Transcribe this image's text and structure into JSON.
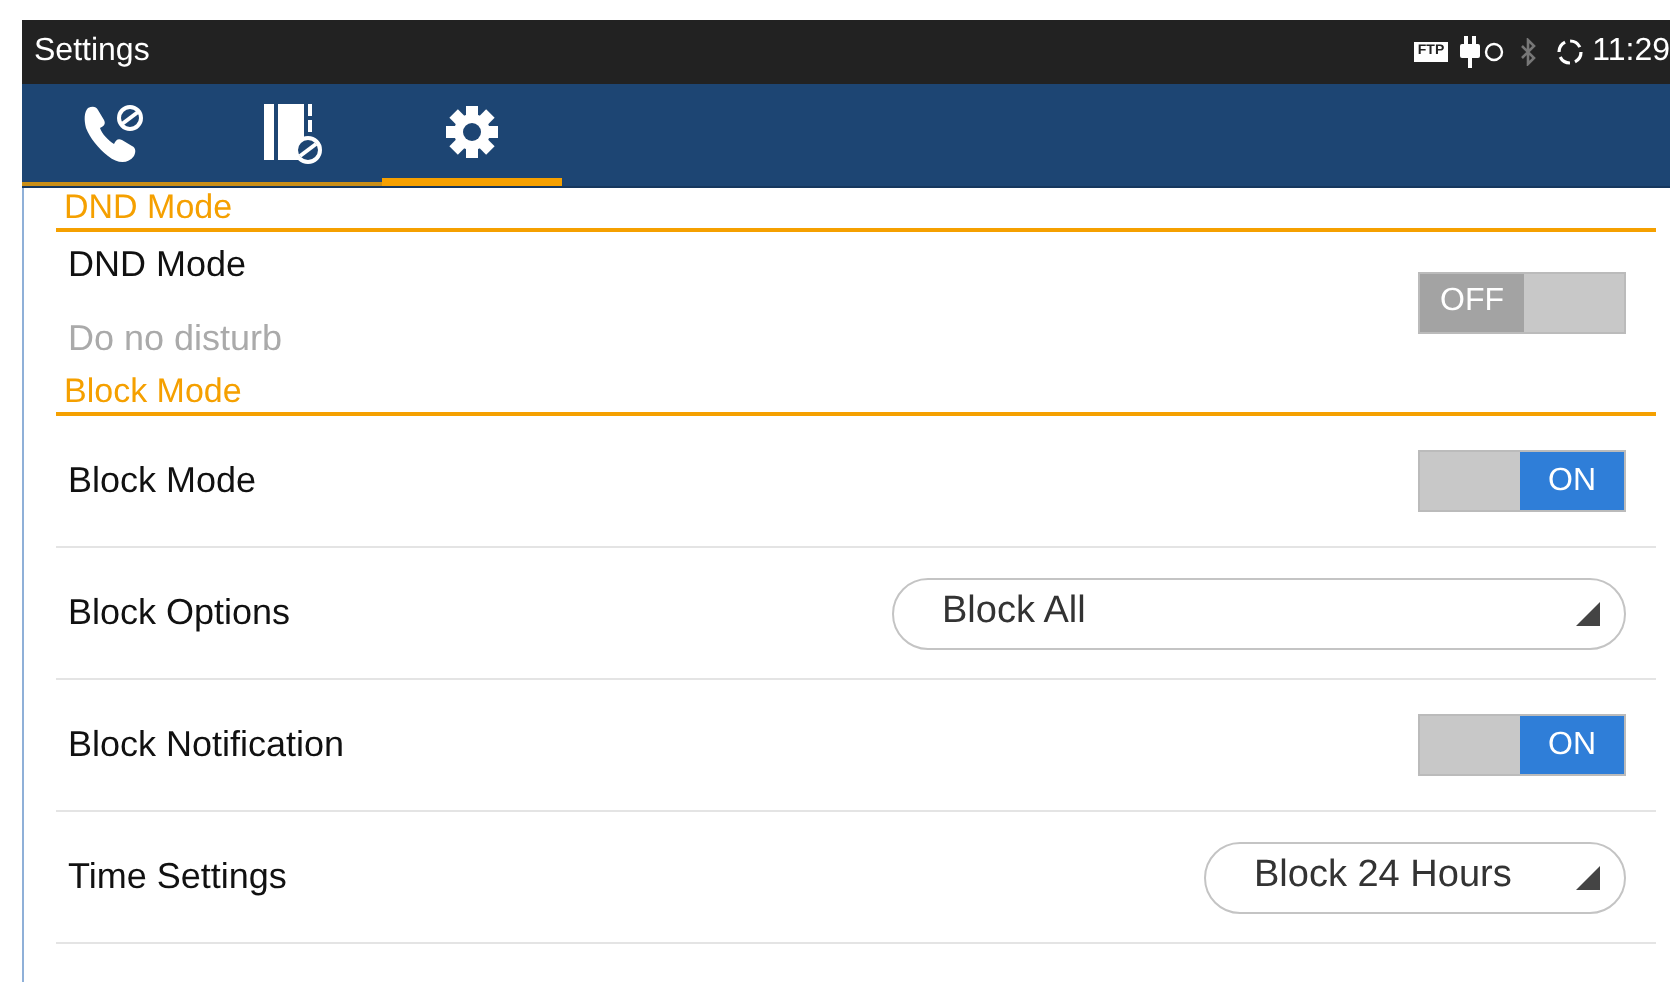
{
  "status_bar": {
    "title": "Settings",
    "indicators": [
      "FTP"
    ],
    "time": "11:29"
  },
  "tabs": [
    {
      "selected": false
    },
    {
      "selected": false
    },
    {
      "selected": true
    }
  ],
  "sections": [
    {
      "header": "DND Mode",
      "rows": [
        {
          "kind": "switch",
          "label": "DND Mode",
          "subtitle": "Do no disturb",
          "on": false,
          "value": "OFF"
        }
      ]
    },
    {
      "header": "Block Mode",
      "rows": [
        {
          "kind": "switch",
          "label": "Block Mode",
          "on": true,
          "value": "ON"
        },
        {
          "kind": "dropdown",
          "label": "Block Options",
          "value": "Block All"
        },
        {
          "kind": "switch",
          "label": "Block Notification",
          "on": true,
          "value": "ON"
        },
        {
          "kind": "dropdown",
          "label": "Time Settings",
          "value": "Block 24 Hours"
        }
      ]
    }
  ]
}
